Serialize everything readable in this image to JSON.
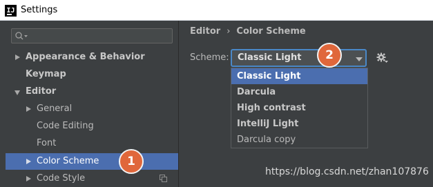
{
  "window": {
    "title": "Settings",
    "app_icon_text": "IJ"
  },
  "search": {
    "placeholder": ""
  },
  "tree": [
    {
      "label": "Appearance & Behavior"
    },
    {
      "label": "Keymap"
    },
    {
      "label": "Editor"
    },
    {
      "label": "General"
    },
    {
      "label": "Code Editing"
    },
    {
      "label": "Font"
    },
    {
      "label": "Color Scheme"
    },
    {
      "label": "Code Style"
    }
  ],
  "breadcrumb": {
    "parent": "Editor",
    "separator": "›",
    "current": "Color Scheme"
  },
  "scheme": {
    "label": "Scheme:",
    "value": "Classic Light",
    "options": [
      "Classic Light",
      "Darcula",
      "High contrast",
      "IntelliJ Light",
      "Darcula copy"
    ]
  },
  "badges": [
    "1",
    "2"
  ],
  "watermark": "https://blog.csdn.net/zhan107876",
  "colors": {
    "background": "#3c3f41",
    "selection": "#4b6eaf",
    "badge": "#e0673b",
    "focus_border": "#4a88c7"
  },
  "icons": [
    "app-icon",
    "search-icon",
    "expand-arrow-icon",
    "collapse-arrow-icon",
    "copy-icon",
    "dropdown-arrow-icon",
    "gear-icon"
  ]
}
